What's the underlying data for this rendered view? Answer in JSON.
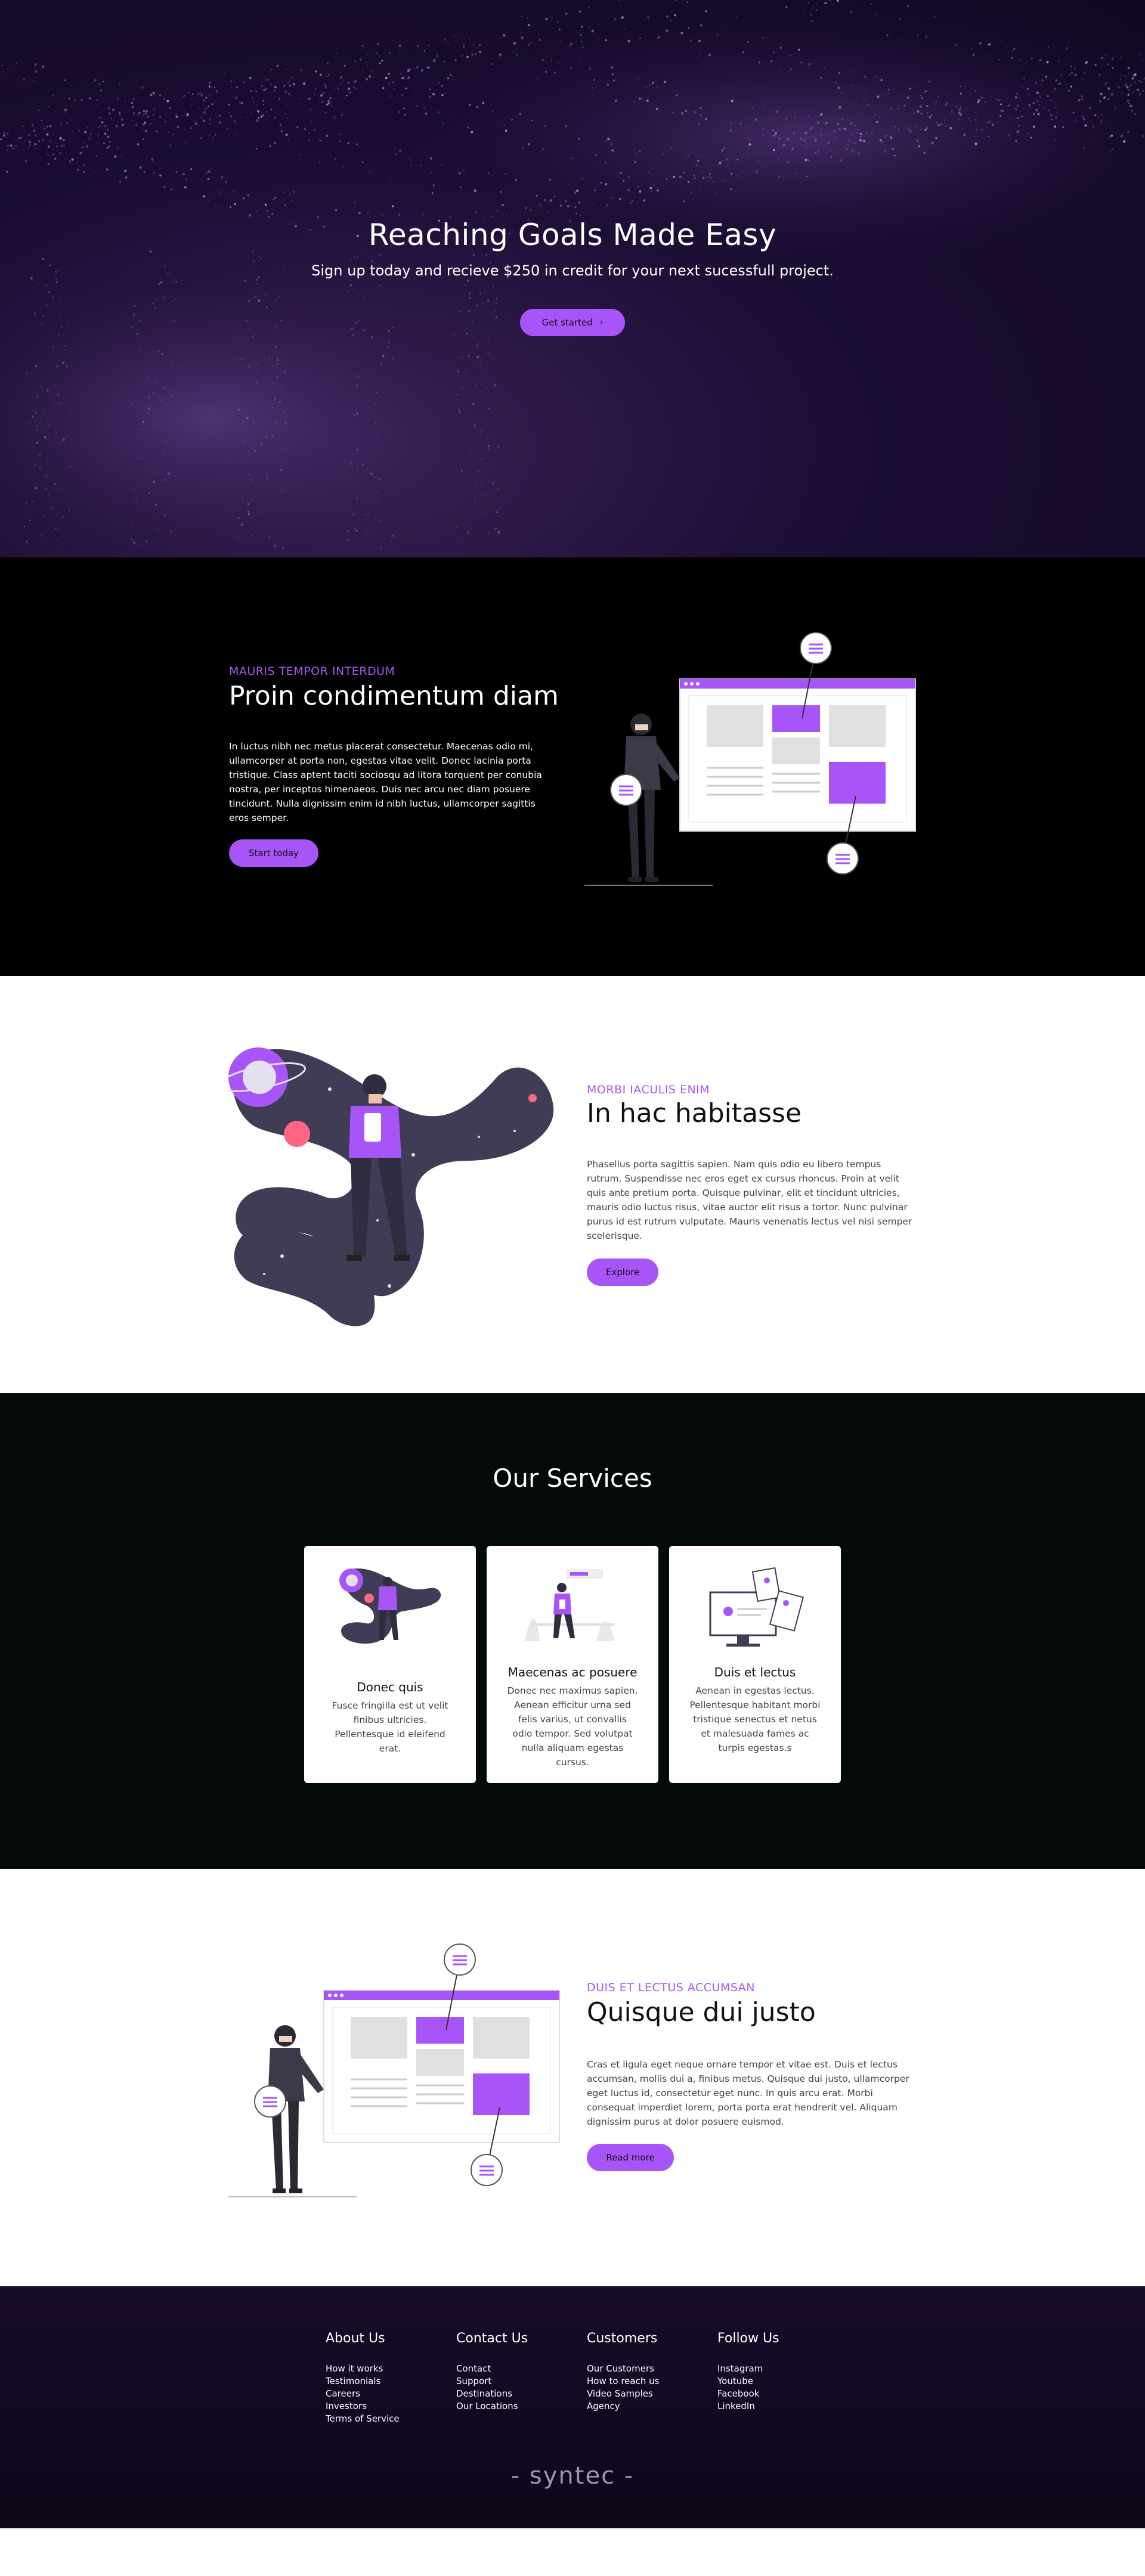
{
  "hero": {
    "title": "Reaching Goals Made Easy",
    "subtitle": "Sign up today and recieve $250 in credit for your next sucessfull project.",
    "button_label": "Get started",
    "button_icon": "chevron-right-icon"
  },
  "section_one": {
    "eyebrow": "MAURIS TEMPOR INTERDUM",
    "title": "Proin condimentum diam",
    "body": "In luctus nibh nec metus placerat consectetur. Maecenas odio mi, ullamcorper at porta non, egestas vitae velit. Donec lacinia porta tristique. Class aptent taciti sociosqu ad litora torquent per conubia nostra, per inceptos himenaeos. Duis nec arcu nec diam posuere tincidunt. Nulla dignissim enim id nibh luctus, ullamcorper sagittis eros semper.",
    "button_label": "Start today"
  },
  "section_two": {
    "eyebrow": "MORBI IACULIS ENIM",
    "title": "In hac habitasse",
    "body": "Phasellus porta sagittis sapien. Nam quis odio eu libero tempus rutrum. Suspendisse nec eros eget ex cursus rhoncus. Proin at velit quis ante pretium porta. Quisque pulvinar, elit et tincidunt ultricies, mauris odio luctus risus, vitae auctor elit risus a tortor. Nunc pulvinar purus id est rutrum vulputate. Mauris venenatis lectus vel nisi semper scelerisque.",
    "button_label": "Explore"
  },
  "services": {
    "title": "Our Services",
    "cards": [
      {
        "title": "Donec quis",
        "body": "Fusce fringilla est ut velit finibus ultricies. Pellentesque id eleifend erat."
      },
      {
        "title": "Maecenas ac posuere",
        "body": "Donec nec maximus sapien. Aenean efficitur urna sed felis varius, ut convallis odio tempor. Sed volutpat nulla aliquam egestas cursus."
      },
      {
        "title": "Duis et lectus",
        "body": "Aenean in egestas lectus. Pellentesque habitant morbi tristique senectus et netus et malesuada fames ac turpis egestas.s"
      }
    ]
  },
  "section_three": {
    "eyebrow": "DUIS ET LECTUS ACCUMSAN",
    "title": "Quisque dui justo",
    "body": "Cras et ligula eget neque ornare tempor et vitae est. Duis et lectus accumsan, mollis dui a, finibus metus. Quisque dui justo, ullamcorper eget luctus id, consectetur eget nunc. In quis arcu erat. Morbi consequat imperdiet lorem, porta porta erat hendrerit vel. Aliquam dignissim purus at dolor posuere euismod.",
    "button_label": "Read more"
  },
  "footer": {
    "columns": [
      {
        "heading": "About Us",
        "links": [
          "How it works",
          "Testimonials",
          "Careers",
          "Investors",
          "Terms of Service"
        ]
      },
      {
        "heading": "Contact Us",
        "links": [
          "Contact",
          "Support",
          "Destinations",
          "Our Locations"
        ]
      },
      {
        "heading": "Customers",
        "links": [
          "Our Customers",
          "How to reach us",
          "Video Samples",
          "Agency"
        ]
      },
      {
        "heading": "Follow Us",
        "links": [
          "Instagram",
          "Youtube",
          "Facebook",
          "LinkedIn"
        ]
      }
    ],
    "brand": "- syntec -"
  },
  "colors": {
    "accent": "#a855f7",
    "hero_bg": "#1b0d33",
    "dark_section": "#000000",
    "services_bg": "#040909",
    "footer_bg": "#170b2a"
  }
}
